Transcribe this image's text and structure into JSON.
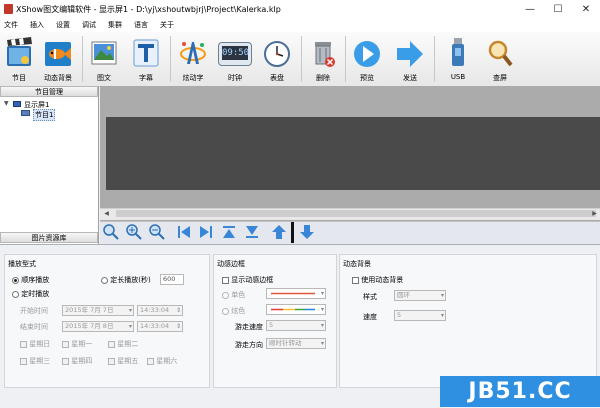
{
  "window": {
    "title": "XShow图文编辑软件 - 显示屏1 - D:\\yj\\xshoutwbjrj\\Project\\Kalerka.klp",
    "minimize": "—",
    "maximize": "☐",
    "close": "✕"
  },
  "menu": [
    "文件",
    "插入",
    "设置",
    "调试",
    "集群",
    "语言",
    "关于"
  ],
  "toolbar": {
    "program": "节目",
    "animated_bg": "动态背景",
    "image_text": "图文",
    "subtitle": "字幕",
    "fancy_text": "炫动字",
    "clock": "时钟",
    "dial": "表盘",
    "delete": "删除",
    "preview": "预览",
    "send": "发送",
    "usb": "USB",
    "search_screen": "查屏",
    "clock_display": "09:50"
  },
  "program_panel": {
    "header": "节目管理",
    "tree": {
      "screen": "显示屏1",
      "program": "节目1"
    },
    "footer": "图片资源库"
  },
  "playback": {
    "title": "播放型式",
    "sequential": "顺序播放",
    "timed_length": "定长播放(秒)",
    "timed_length_value": "600",
    "scheduled": "定时播放",
    "start_label": "开始时间",
    "end_label": "结束时间",
    "start_date": "2015年 7月 7日",
    "start_time": "14:33:04",
    "end_date": "2015年 7月 8日",
    "end_time": "14:33:04",
    "weekdays": [
      "星期日",
      "星期一",
      "星期二",
      "星期三",
      "星期四",
      "星期五",
      "星期六"
    ]
  },
  "animated_border": {
    "title": "动感边框",
    "show_label": "显示动感边框",
    "single_color": "单色",
    "multi_color": "炫色",
    "speed_label": "游走速度",
    "speed_value": "5",
    "direction_label": "游走方向",
    "direction_value": "顺时针转动"
  },
  "animated_background": {
    "title": "动态背景",
    "use_label": "使用动态背景",
    "style_label": "样式",
    "style_value": "圆环",
    "speed_label": "速度",
    "speed_value": "5"
  },
  "watermark": "JB51.CC"
}
